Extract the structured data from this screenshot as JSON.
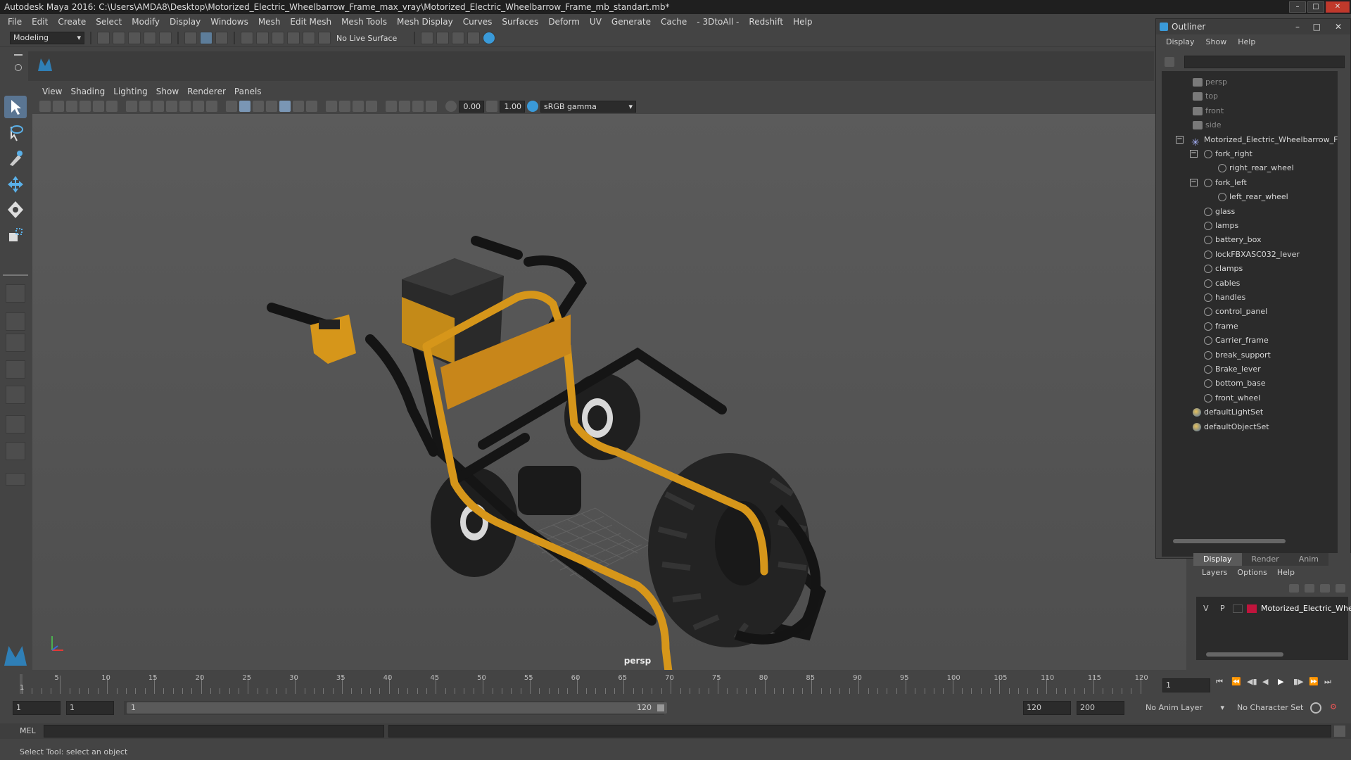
{
  "titlebar": {
    "text": "Autodesk Maya 2016: C:\\Users\\AMDA8\\Desktop\\Motorized_Electric_Wheelbarrow_Frame_max_vray\\Motorized_Electric_Wheelbarrow_Frame_mb_standart.mb*"
  },
  "menubar": [
    "File",
    "Edit",
    "Create",
    "Select",
    "Modify",
    "Display",
    "Windows",
    "Mesh",
    "Edit Mesh",
    "Mesh Tools",
    "Mesh Display",
    "Curves",
    "Surfaces",
    "Deform",
    "UV",
    "Generate",
    "Cache",
    "- 3DtoAll -",
    "Redshift",
    "Help"
  ],
  "statusline": {
    "mode": "Modeling",
    "live_surface": "No Live Surface"
  },
  "panel": {
    "menus": [
      "View",
      "Shading",
      "Lighting",
      "Show",
      "Renderer",
      "Panels"
    ],
    "exposure": "0.00",
    "gamma": "1.00",
    "color_space": "sRGB gamma",
    "camera": "persp"
  },
  "outliner": {
    "title": "Outliner",
    "menus": [
      "Display",
      "Show",
      "Help"
    ],
    "cameras": [
      "persp",
      "top",
      "front",
      "side"
    ],
    "root": "Motorized_Electric_Wheelbarrow_F",
    "children": [
      {
        "label": "fork_right",
        "child": "right_rear_wheel"
      },
      {
        "label": "fork_left",
        "child": "left_rear_wheel"
      }
    ],
    "items": [
      "glass",
      "lamps",
      "battery_box",
      "lockFBXASC032_lever",
      "clamps",
      "cables",
      "handles",
      "control_panel",
      "frame",
      "Carrier_frame",
      "break_support",
      "Brake_lever",
      "bottom_base",
      "front_wheel"
    ],
    "sets": [
      "defaultLightSet",
      "defaultObjectSet"
    ]
  },
  "layers": {
    "tabs": [
      "Display",
      "Render",
      "Anim"
    ],
    "menus": [
      "Layers",
      "Options",
      "Help"
    ],
    "row": {
      "v": "V",
      "p": "P",
      "name": "Motorized_Electric_Whe",
      "color": "#c0143c"
    }
  },
  "timeline": {
    "ticks": [
      "5",
      "10",
      "15",
      "20",
      "25",
      "30",
      "35",
      "40",
      "45",
      "50",
      "55",
      "60",
      "65",
      "70",
      "75",
      "80",
      "85",
      "90",
      "95",
      "100",
      "105",
      "110",
      "115",
      "120"
    ],
    "start_marker": "1",
    "current_frame": "1"
  },
  "range": {
    "start": "1",
    "anim_start": "1",
    "slider_start": "1",
    "slider_end": "120",
    "anim_end": "120",
    "end": "200",
    "anim_layer": "No Anim Layer",
    "char_set": "No Character Set"
  },
  "cmdline": {
    "label": "MEL"
  },
  "helpline": {
    "text": "Select Tool: select an object"
  },
  "colors": {
    "frame_yellow": "#d6961a",
    "tire_dark": "#1e1e1e",
    "accent_blue": "#5a7592"
  }
}
